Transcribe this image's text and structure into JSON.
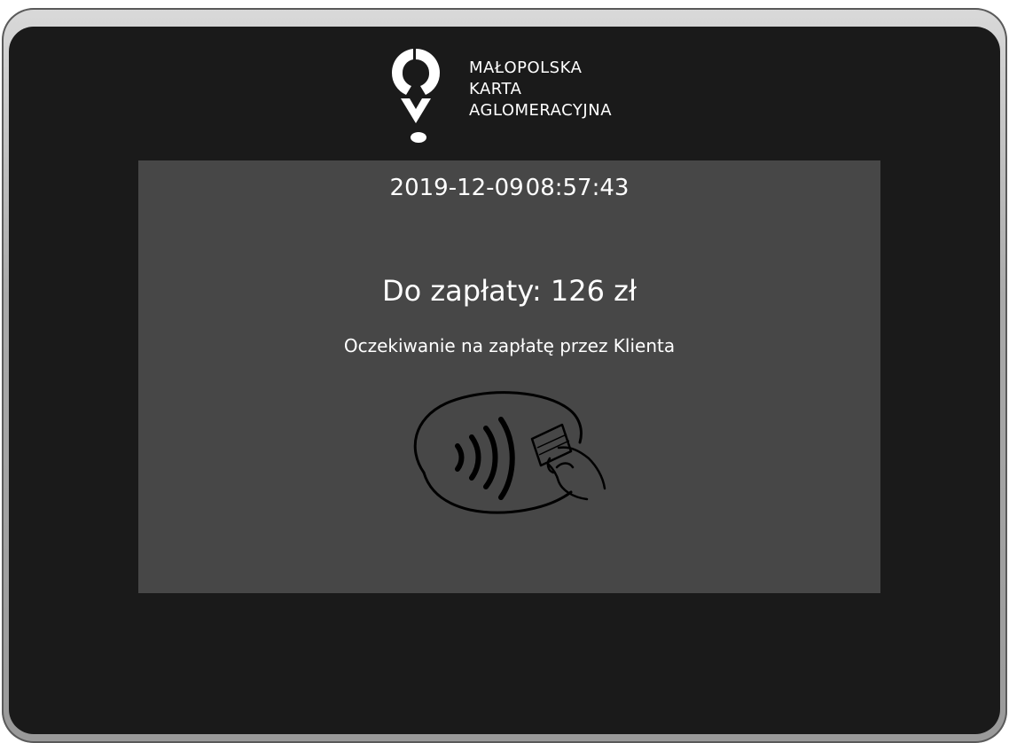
{
  "logo": {
    "line1": "MAŁOPOLSKA",
    "line2": "KARTA",
    "line3": "AGLOMERACYJNA"
  },
  "datetime": {
    "date": "2019-12-09",
    "time": "08:57:43"
  },
  "payment": {
    "amount_label": "Do zapłaty:",
    "amount_value": "126 zł",
    "status": "Oczekiwanie na zapłatę przez Klienta"
  },
  "icons": {
    "logo_mark": "location-pin-logo-icon",
    "contactless": "contactless-payment-icon"
  },
  "colors": {
    "screen": "#1a1a1a",
    "panel": "#474747",
    "text": "#ffffff",
    "bezel": "#a9a9a9"
  }
}
